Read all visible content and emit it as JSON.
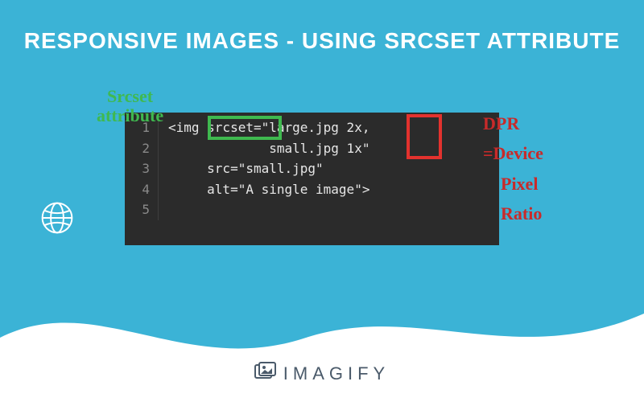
{
  "title": "RESPONSIVE IMAGES - USING SRCSET ATTRIBUTE",
  "code": {
    "line1": "<img srcset=\"large.jpg 2x,",
    "line2": "             small.jpg 1x\"",
    "line3": "     src=\"small.jpg\"",
    "line4": "     alt=\"A single image\">",
    "line5": ""
  },
  "line_numbers": [
    "1",
    "2",
    "3",
    "4",
    "5"
  ],
  "annotations": {
    "srcset_label_l1": "Srcset",
    "srcset_label_l2": "attribute",
    "dpr_l1": "DPR",
    "dpr_l2": "=Device",
    "dpr_l3": "Pixel",
    "dpr_l4": "Ratio"
  },
  "brand": "IMAGIFY",
  "colors": {
    "bg": "#3bb3d6",
    "code_bg": "#2b2b2b",
    "green": "#3fb94f",
    "red": "#c82a2a"
  }
}
